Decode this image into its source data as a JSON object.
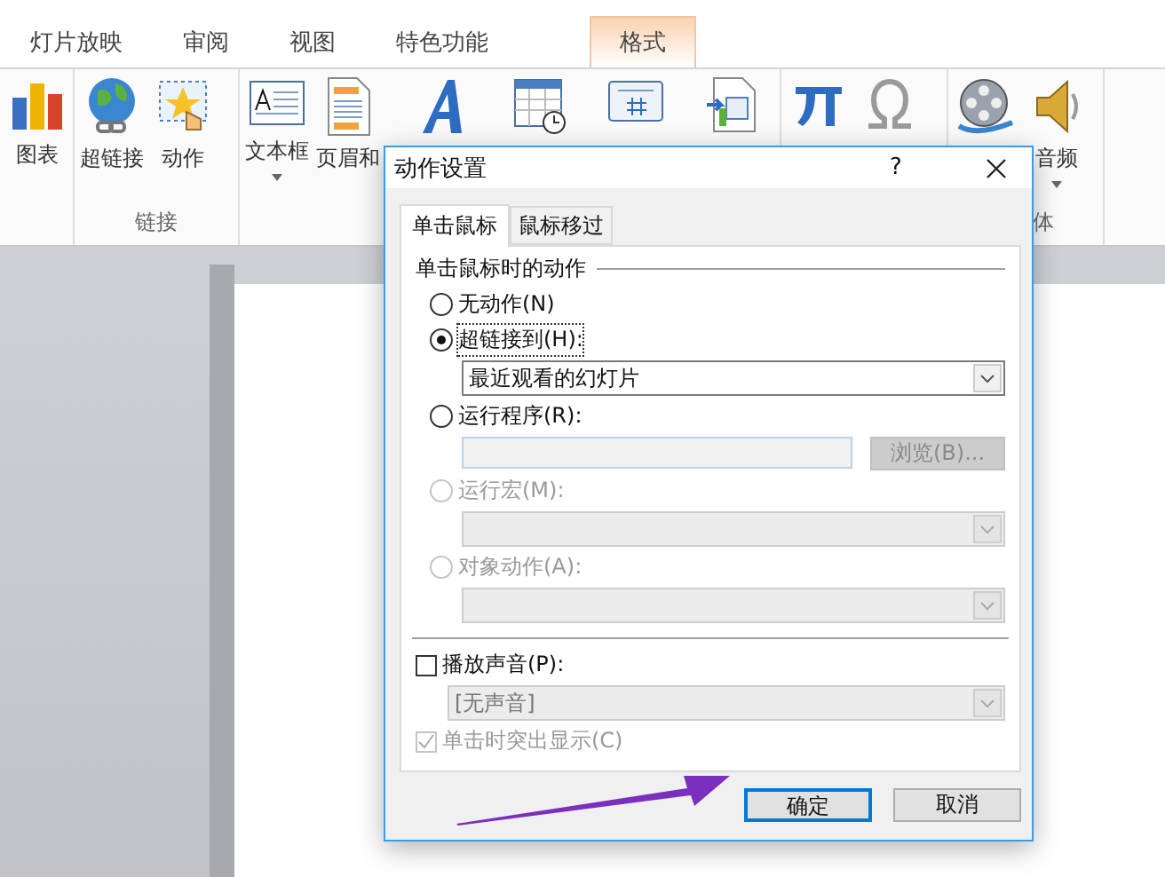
{
  "ribbon_tabs": [
    {
      "label": "灯片放映",
      "selected": false,
      "kind": "normal"
    },
    {
      "label": "审阅",
      "selected": false,
      "kind": "normal"
    },
    {
      "label": "视图",
      "selected": false,
      "kind": "normal"
    },
    {
      "label": "特色功能",
      "selected": false,
      "kind": "normal"
    },
    {
      "label": "格式",
      "selected": true,
      "kind": "contextual"
    }
  ],
  "ribbon_groups": [
    {
      "items": [
        {
          "kind": "large",
          "label": "图表"
        }
      ]
    },
    {
      "label": "链接",
      "items": [
        {
          "kind": "large",
          "label": "超链接"
        },
        {
          "kind": "large",
          "label": "动作"
        }
      ]
    },
    {
      "items": [
        {
          "kind": "large",
          "label": "文本框",
          "has_menu": true
        },
        {
          "kind": "large",
          "label": "页眉和"
        },
        {
          "kind": "large"
        },
        {
          "kind": "large"
        },
        {
          "kind": "large"
        },
        {
          "kind": "large"
        }
      ]
    },
    {
      "items": [
        {
          "kind": "large"
        },
        {
          "kind": "large"
        }
      ]
    },
    {
      "label": "体",
      "items": [
        {
          "kind": "large"
        },
        {
          "kind": "large",
          "label": "音频",
          "has_menu": true
        }
      ]
    }
  ],
  "dialog": {
    "title": "动作设置",
    "help": "?",
    "tabs": [
      {
        "label": "单击鼠标",
        "selected": true
      },
      {
        "label": "鼠标移过",
        "selected": false
      }
    ],
    "section_title": "单击鼠标时的动作",
    "options": [
      {
        "label": "无动作(N)",
        "selected": false,
        "disabled": false
      },
      {
        "label": "超链接到(H):",
        "selected": true,
        "disabled": false,
        "field": {
          "kind": "dropdown",
          "value": "最近观看的幻灯片",
          "disabled": false
        }
      },
      {
        "label": "运行程序(R):",
        "selected": false,
        "disabled": false,
        "field": {
          "kind": "text",
          "disabled": true
        },
        "browse": {
          "label": "浏览(B)...",
          "disabled": true
        }
      },
      {
        "label": "运行宏(M):",
        "selected": false,
        "disabled": true,
        "field": {
          "kind": "dropdown",
          "disabled": true
        }
      },
      {
        "label": "对象动作(A):",
        "selected": false,
        "disabled": true,
        "field": {
          "kind": "dropdown",
          "disabled": true
        }
      }
    ],
    "sound": {
      "label": "播放声音(P):",
      "checked": false,
      "disabled": false,
      "field": {
        "kind": "dropdown",
        "value": "[无声音]",
        "disabled": true
      }
    },
    "highlight": {
      "label": "单击时突出显示(C)",
      "checked": true,
      "disabled": true
    },
    "buttons": [
      {
        "label": "确定",
        "default": true
      },
      {
        "label": "取消",
        "default": false
      }
    ]
  }
}
